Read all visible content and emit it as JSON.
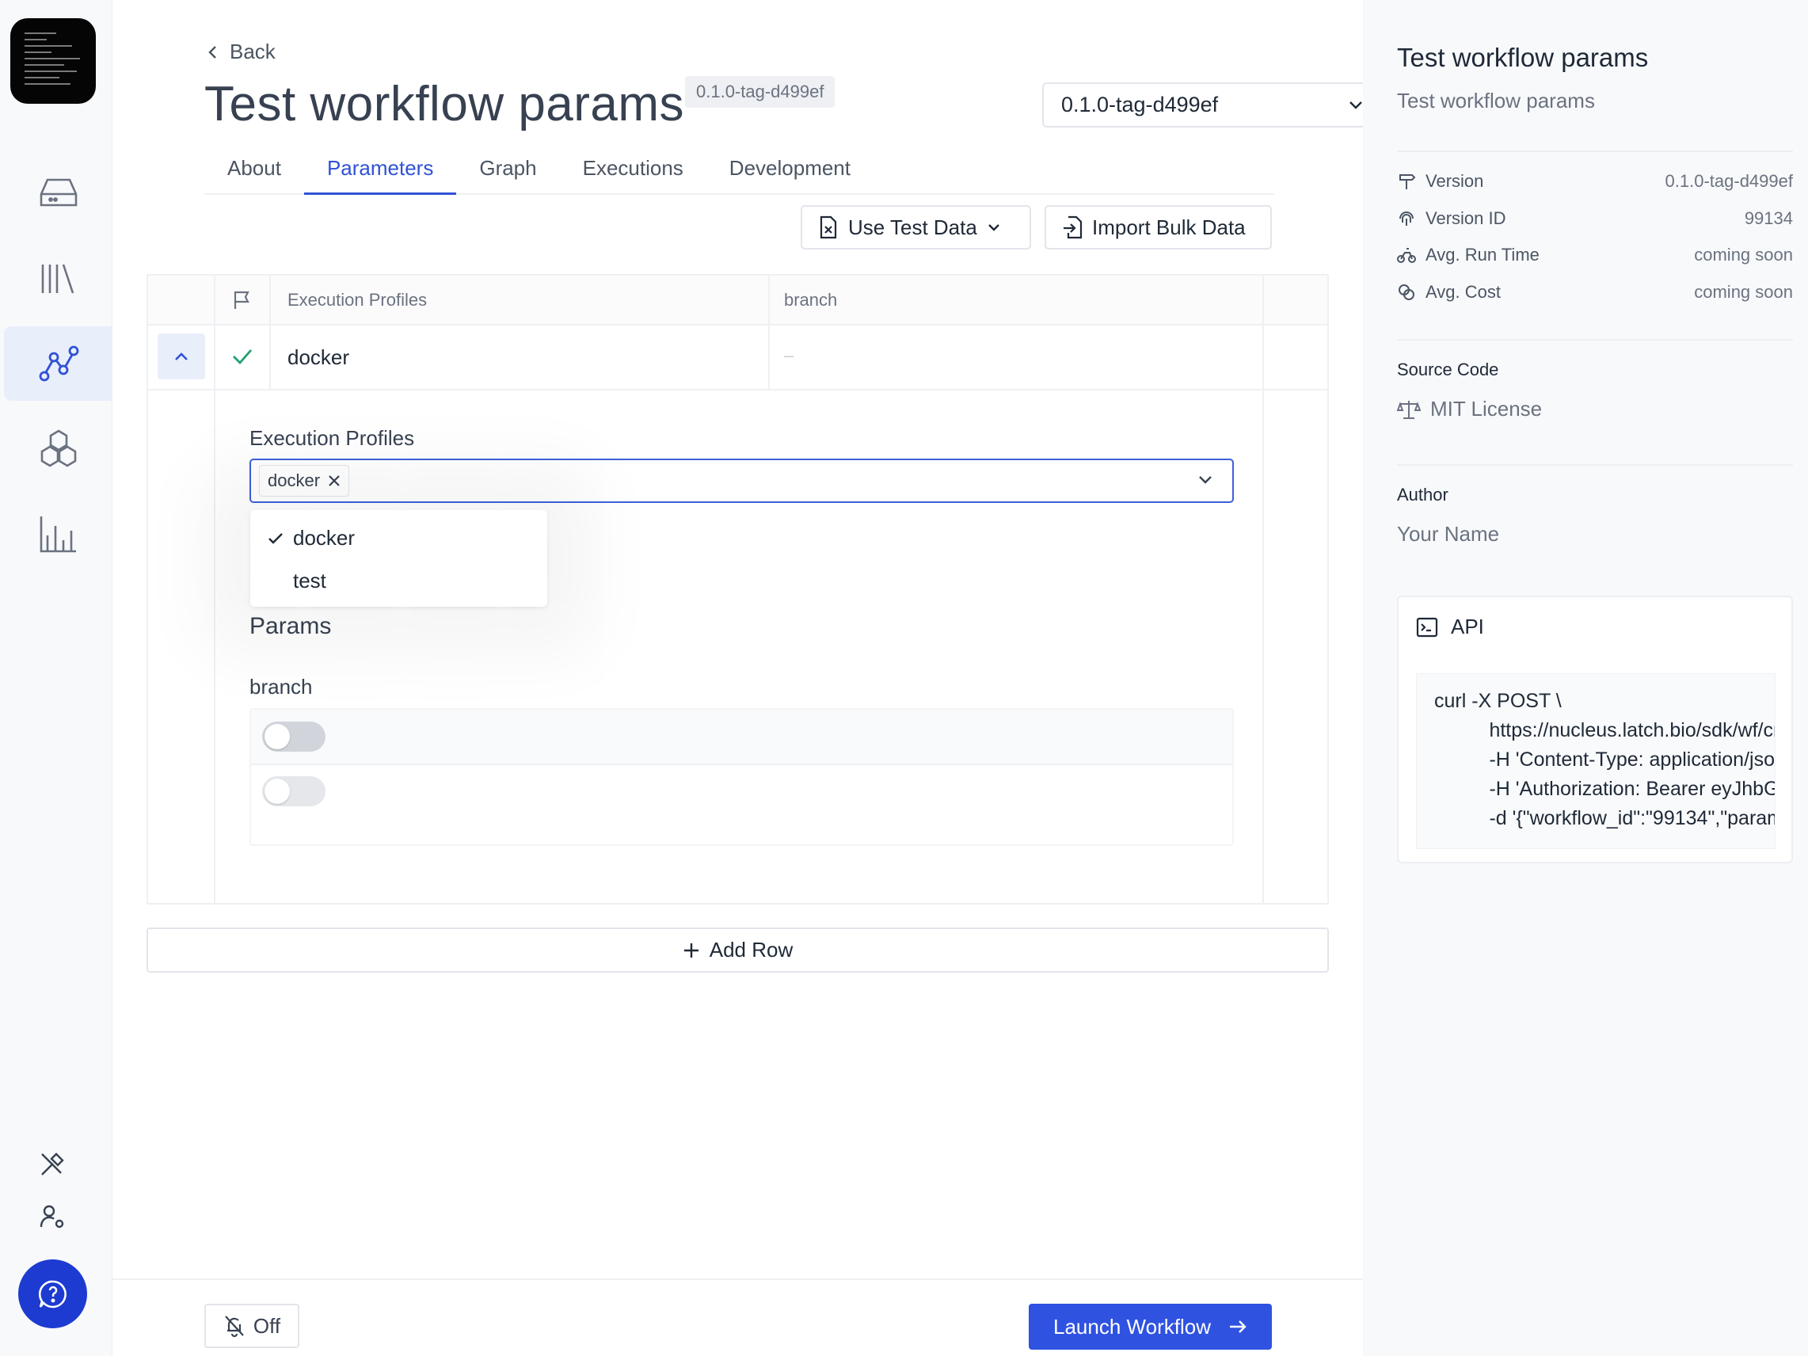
{
  "page": {
    "title": "Test workflow params",
    "back_label": "Back",
    "version_badge": "0.1.0-tag-d499ef",
    "version_select": "0.1.0-tag-d499ef"
  },
  "tabs": [
    {
      "label": "About"
    },
    {
      "label": "Parameters"
    },
    {
      "label": "Graph"
    },
    {
      "label": "Executions"
    },
    {
      "label": "Development"
    }
  ],
  "toolbar": {
    "use_test_data": "Use Test Data",
    "import_bulk": "Import Bulk Data"
  },
  "table": {
    "headers": {
      "profiles": "Execution Profiles",
      "branch": "branch"
    },
    "row": {
      "profile": "docker",
      "branch": "–"
    }
  },
  "detail": {
    "profiles_label": "Execution Profiles",
    "chip": "docker",
    "options": [
      {
        "label": "docker",
        "selected": true
      },
      {
        "label": "test",
        "selected": false
      }
    ],
    "params_heading": "Params",
    "branch_label": "branch"
  },
  "add_row": "Add Row",
  "footer": {
    "notify": "Off",
    "launch": "Launch Workflow"
  },
  "info": {
    "title": "Test workflow params",
    "subtitle": "Test workflow params",
    "version_k": "Version",
    "version_v": "0.1.0-tag-d499ef",
    "vid_k": "Version ID",
    "vid_v": "99134",
    "run_k": "Avg. Run Time",
    "run_v": "coming soon",
    "cost_k": "Avg. Cost",
    "cost_v": "coming soon",
    "source_h": "Source Code",
    "license": "MIT License",
    "author_h": "Author",
    "author": "Your Name",
    "api_h": "API",
    "code": "curl -X POST \\\n          https://nucleus.latch.bio/sdk/wf/create \\\n          -H 'Content-Type: application/json' \\\n          -H 'Authorization: Bearer eyJhbGc...' \\\n          -d '{\"workflow_id\":\"99134\",\"params\":{}}'"
  },
  "colors": {
    "accent": "#2f52d6",
    "launch": "#2f52e0",
    "help": "#1d3bd1",
    "check": "#22a06b"
  }
}
